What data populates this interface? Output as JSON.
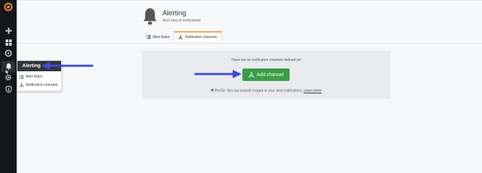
{
  "sidebar": {
    "items": [
      {
        "icon": "grafana-logo-icon"
      },
      {
        "icon": "plus-icon"
      },
      {
        "icon": "dashboards-icon"
      },
      {
        "icon": "explore-compass-icon"
      },
      {
        "icon": "bell-icon"
      },
      {
        "icon": "gear-icon"
      },
      {
        "icon": "shield-icon"
      }
    ]
  },
  "flyout": {
    "title": "Alerting",
    "items": [
      {
        "label": "Alert Rules",
        "icon": "list-icon"
      },
      {
        "label": "Notification channels",
        "icon": "share-icon"
      }
    ]
  },
  "header": {
    "title": "Alerting",
    "subtitle": "Alert rules & notifications"
  },
  "tabs": [
    {
      "label": "Alert Rules",
      "icon": "list-icon",
      "active": false
    },
    {
      "label": "Notification channels",
      "icon": "share-icon",
      "active": true
    }
  ],
  "panel": {
    "empty_message": "There are no notification channels defined yet",
    "add_button_label": "Add channel",
    "protip_text": "ProTip: You can include images in your alert notifications.",
    "protip_link": "Learn more"
  },
  "colors": {
    "sidebar_bg": "#141619",
    "accent_orange": "#f0a44d",
    "button_green": "#3a9e46",
    "annotation_arrow": "#3b4bdc"
  }
}
